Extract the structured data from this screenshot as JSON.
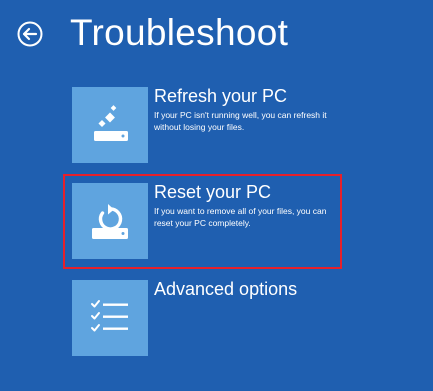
{
  "header": {
    "title": "Troubleshoot",
    "back_icon": "back-arrow-circle-icon"
  },
  "options": [
    {
      "title": "Refresh your PC",
      "description": "If your PC isn't running well, you can refresh it without losing your files.",
      "icon": "refresh-pc-icon"
    },
    {
      "title": "Reset your PC",
      "description": "If you want to remove all of your files, you can reset your PC completely.",
      "icon": "reset-pc-icon",
      "highlighted": true
    },
    {
      "title": "Advanced options",
      "description": "",
      "icon": "checklist-icon"
    }
  ],
  "colors": {
    "background": "#1f5fb0",
    "tile": "#5fa4df",
    "highlight": "#e8202a",
    "text": "#ffffff"
  }
}
